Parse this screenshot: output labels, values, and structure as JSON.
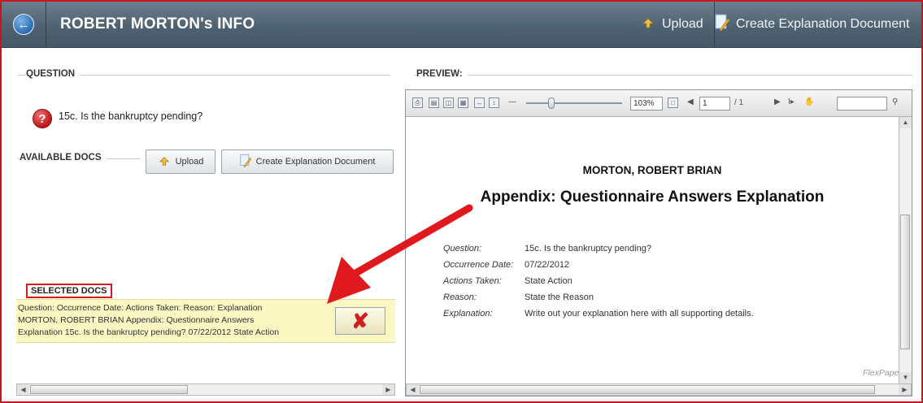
{
  "header": {
    "back_icon": "back-arrow-icon",
    "title": "ROBERT MORTON's INFO",
    "upload_label": "Upload",
    "create_label": "Create Explanation Document"
  },
  "question": {
    "caption": "QUESTION",
    "icon": "question-mark-icon",
    "text": "15c. Is the bankruptcy pending?"
  },
  "available_docs": {
    "caption": "AVAILABLE DOCS",
    "upload_label": "Upload",
    "create_label": "Create Explanation Document"
  },
  "selected_docs": {
    "caption": "SELECTED DOCS",
    "line1": "Question: Occurrence Date: Actions Taken: Reason: Explanation",
    "line2": "MORTON, ROBERT BRIAN Appendix: Questionnaire Answers",
    "line3": "Explanation 15c. Is the bankruptcy pending? 07/22/2012 State Action",
    "remove_icon": "red-x-delete-icon"
  },
  "preview": {
    "caption": "PREVIEW:",
    "zoom": "103%",
    "page": "1",
    "page_total": "/ 1",
    "search_placeholder": "",
    "doc_name": "MORTON, ROBERT BRIAN",
    "doc_title": "Appendix: Questionnaire Answers Explanation",
    "rows": [
      {
        "key": "Question:",
        "value": "15c. Is the bankruptcy pending?"
      },
      {
        "key": "Occurrence Date:",
        "value": "07/22/2012"
      },
      {
        "key": "Actions Taken:",
        "value": "State Action"
      },
      {
        "key": "Reason:",
        "value": "State the Reason"
      },
      {
        "key": "Explanation:",
        "value": "Write out your explanation here with all supporting details."
      }
    ],
    "watermark": "FlexPaper"
  },
  "colors": {
    "accent_red": "#c4161c",
    "titlebar": "#4f6272",
    "selected_bg": "#fbf7c3"
  }
}
